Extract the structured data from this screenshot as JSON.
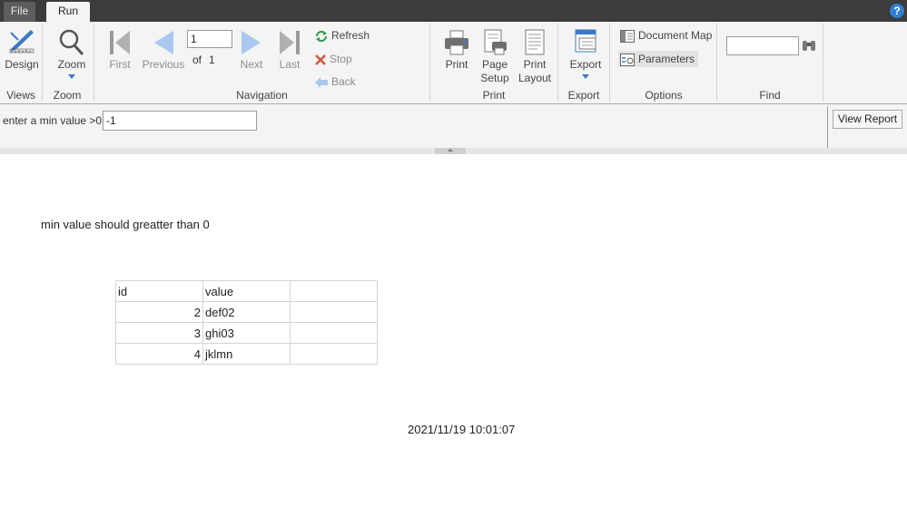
{
  "tabs": {
    "file": "File",
    "run": "Run"
  },
  "help": {
    "label": "?"
  },
  "ribbon": {
    "views": {
      "design": "Design",
      "group": "Views"
    },
    "zoom": {
      "zoom": "Zoom",
      "group": "Zoom"
    },
    "navigation": {
      "first": "First",
      "previous": "Previous",
      "page": "1",
      "of": "of",
      "total": "1",
      "next": "Next",
      "last": "Last",
      "refresh": "Refresh",
      "stop": "Stop",
      "back": "Back",
      "group": "Navigation"
    },
    "print": {
      "print": "Print",
      "page_setup_1": "Page",
      "page_setup_2": "Setup",
      "print_layout_1": "Print",
      "print_layout_2": "Layout",
      "group": "Print"
    },
    "export": {
      "export": "Export",
      "group": "Export"
    },
    "options": {
      "document_map": "Document Map",
      "parameters": "Parameters",
      "group": "Options"
    },
    "find": {
      "value": "",
      "group": "Find"
    }
  },
  "parameters": {
    "label": "enter a min value >0",
    "value": "-1",
    "view_report": "View Report"
  },
  "report": {
    "message": "min value should greatter than 0",
    "table": {
      "headers": [
        "id",
        "value",
        ""
      ],
      "rows": [
        [
          "2",
          "def02",
          ""
        ],
        [
          "3",
          "ghi03",
          ""
        ],
        [
          "4",
          "jklmn",
          ""
        ]
      ]
    },
    "timestamp": "2021/11/19 10:01:07"
  },
  "colors": {
    "tabbar": "#3c3c3c",
    "ribbon": "#f4f4f4",
    "accent": "#2f7fd6",
    "disabled_arrow": "#a9c8ef",
    "disabled_icon": "#9a9a9a"
  }
}
